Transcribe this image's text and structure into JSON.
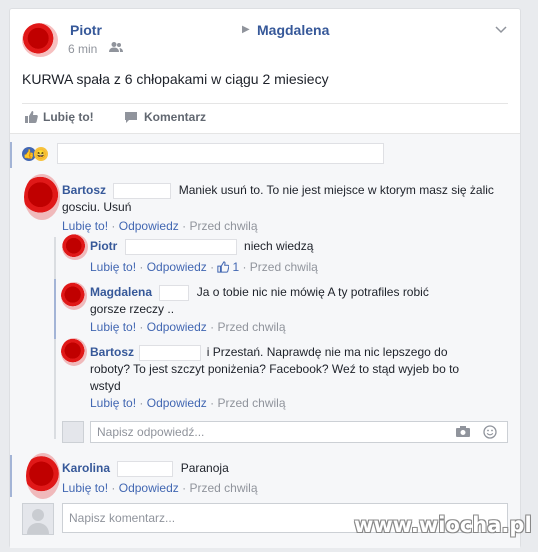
{
  "post": {
    "author": "Piotr",
    "target": "Magdalena",
    "time": "6 min",
    "body": "KURWA spała z 6 chłopakami w ciągu 2 miesiecy",
    "actions": {
      "like": "Lubię to!",
      "comment": "Komentarz"
    }
  },
  "colors": {
    "link": "#4267b2",
    "name": "#365899",
    "meta": "#90949c",
    "background": "#e9ebee"
  },
  "comments": [
    {
      "author": "Bartosz",
      "text": "Maniek usuń to. To nie jest miejsce w ktorym masz się żalic gosciu. Usuń",
      "like": "Lubię to!",
      "reply": "Odpowiedz",
      "time": "Przed chwilą"
    },
    {
      "author": "Piotr",
      "text": "niech wiedzą",
      "like": "Lubię to!",
      "reply": "Odpowiedz",
      "likes": "1",
      "time": "Przed chwilą"
    },
    {
      "author": "Magdalena",
      "text": "Ja o tobie nic nie mówię A ty potrafiles robić gorsze rzeczy ..",
      "like": "Lubię to!",
      "reply": "Odpowiedz",
      "time": "Przed chwilą"
    },
    {
      "author": "Bartosz",
      "text": "i Przestań. Naprawdę nie ma nic lepszego do roboty? To jest szczyt poniżenia? Facebook? Weź to stąd wyjeb bo to wstyd",
      "like": "Lubię to!",
      "reply": "Odpowiedz",
      "time": "Przed chwilą"
    },
    {
      "author": "Karolina",
      "text": "Paranoja",
      "like": "Lubię to!",
      "reply": "Odpowiedz",
      "time": "Przed chwilą"
    }
  ],
  "reply_box": {
    "placeholder": "Napisz odpowiedź..."
  },
  "comment_box": {
    "placeholder": "Napisz komentarz..."
  },
  "watermark": "www.wiocha.pl"
}
